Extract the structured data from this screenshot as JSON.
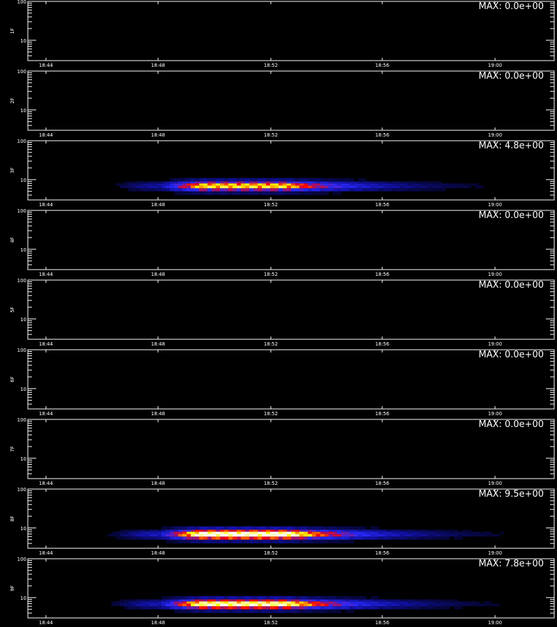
{
  "chart_data": {
    "type": "heatmap",
    "x_ticks": [
      "18:44",
      "18:48",
      "18:52",
      "18:56",
      "19:00"
    ],
    "y_scale": "log",
    "ylim": [
      3,
      100
    ],
    "y_ticks": [
      "100",
      "10"
    ],
    "colormap": [
      "#000000",
      "#1010a0",
      "#2a2aff",
      "#ff0000",
      "#ffff00",
      "#ffffff"
    ],
    "axes_color": "#ffffff",
    "background": "#000000",
    "panels": [
      {
        "label": "1F",
        "max_label": "MAX: 0.0e+00",
        "max_value": 0.0
      },
      {
        "label": "2F",
        "max_label": "MAX: 0.0e+00",
        "max_value": 0.0
      },
      {
        "label": "3F",
        "max_label": "MAX: 4.8e+00",
        "max_value": 4.8
      },
      {
        "label": "4F",
        "max_label": "MAX: 0.0e+00",
        "max_value": 0.0
      },
      {
        "label": "5F",
        "max_label": "MAX: 0.0e+00",
        "max_value": 0.0
      },
      {
        "label": "6F",
        "max_label": "MAX: 0.0e+00",
        "max_value": 0.0
      },
      {
        "label": "7F",
        "max_label": "MAX: 0.0e+00",
        "max_value": 0.0
      },
      {
        "label": "8F",
        "max_label": "MAX: 9.5e+00",
        "max_value": 9.5
      },
      {
        "label": "9F",
        "max_label": "MAX: 7.8e+00",
        "max_value": 7.8
      }
    ]
  }
}
